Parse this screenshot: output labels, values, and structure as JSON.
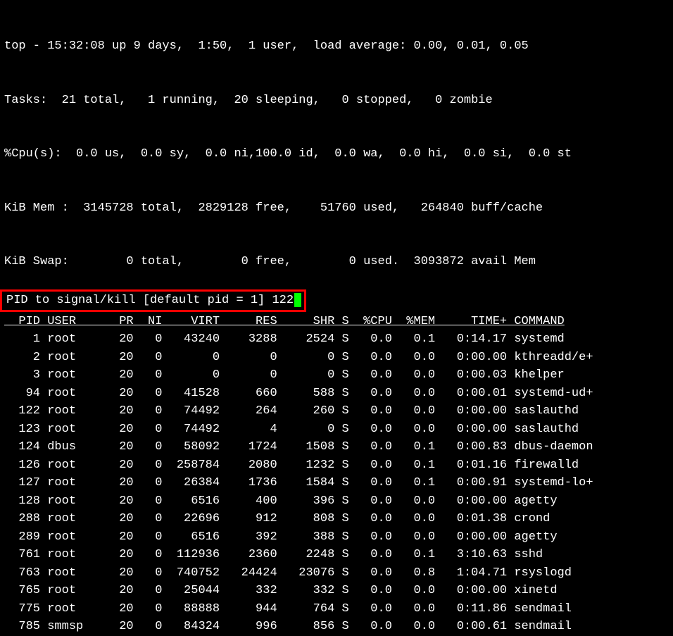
{
  "summary": {
    "line1": "top - 15:32:08 up 9 days,  1:50,  1 user,  load average: 0.00, 0.01, 0.05",
    "line2": "Tasks:  21 total,   1 running,  20 sleeping,   0 stopped,   0 zombie",
    "line3": "%Cpu(s):  0.0 us,  0.0 sy,  0.0 ni,100.0 id,  0.0 wa,  0.0 hi,  0.0 si,  0.0 st",
    "line4": "KiB Mem :  3145728 total,  2829128 free,    51760 used,   264840 buff/cache",
    "line5": "KiB Swap:        0 total,        0 free,        0 used.  3093872 avail Mem"
  },
  "prompt": {
    "text": "PID to signal/kill [default pid = 1] ",
    "value": "122"
  },
  "columns": {
    "pid": "PID",
    "user": "USER",
    "pr": "PR",
    "ni": "NI",
    "virt": "VIRT",
    "res": "RES",
    "shr": "SHR",
    "s": "S",
    "cpu": "%CPU",
    "mem": "%MEM",
    "time": "TIME+",
    "command": "COMMAND"
  },
  "processes": [
    {
      "pid": "1",
      "user": "root",
      "pr": "20",
      "ni": "0",
      "virt": "43240",
      "res": "3288",
      "shr": "2524",
      "s": "S",
      "cpu": "0.0",
      "mem": "0.1",
      "time": "0:14.17",
      "command": "systemd"
    },
    {
      "pid": "2",
      "user": "root",
      "pr": "20",
      "ni": "0",
      "virt": "0",
      "res": "0",
      "shr": "0",
      "s": "S",
      "cpu": "0.0",
      "mem": "0.0",
      "time": "0:00.00",
      "command": "kthreadd/e+"
    },
    {
      "pid": "3",
      "user": "root",
      "pr": "20",
      "ni": "0",
      "virt": "0",
      "res": "0",
      "shr": "0",
      "s": "S",
      "cpu": "0.0",
      "mem": "0.0",
      "time": "0:00.03",
      "command": "khelper"
    },
    {
      "pid": "94",
      "user": "root",
      "pr": "20",
      "ni": "0",
      "virt": "41528",
      "res": "660",
      "shr": "588",
      "s": "S",
      "cpu": "0.0",
      "mem": "0.0",
      "time": "0:00.01",
      "command": "systemd-ud+"
    },
    {
      "pid": "122",
      "user": "root",
      "pr": "20",
      "ni": "0",
      "virt": "74492",
      "res": "264",
      "shr": "260",
      "s": "S",
      "cpu": "0.0",
      "mem": "0.0",
      "time": "0:00.00",
      "command": "saslauthd"
    },
    {
      "pid": "123",
      "user": "root",
      "pr": "20",
      "ni": "0",
      "virt": "74492",
      "res": "4",
      "shr": "0",
      "s": "S",
      "cpu": "0.0",
      "mem": "0.0",
      "time": "0:00.00",
      "command": "saslauthd"
    },
    {
      "pid": "124",
      "user": "dbus",
      "pr": "20",
      "ni": "0",
      "virt": "58092",
      "res": "1724",
      "shr": "1508",
      "s": "S",
      "cpu": "0.0",
      "mem": "0.1",
      "time": "0:00.83",
      "command": "dbus-daemon"
    },
    {
      "pid": "126",
      "user": "root",
      "pr": "20",
      "ni": "0",
      "virt": "258784",
      "res": "2080",
      "shr": "1232",
      "s": "S",
      "cpu": "0.0",
      "mem": "0.1",
      "time": "0:01.16",
      "command": "firewalld"
    },
    {
      "pid": "127",
      "user": "root",
      "pr": "20",
      "ni": "0",
      "virt": "26384",
      "res": "1736",
      "shr": "1584",
      "s": "S",
      "cpu": "0.0",
      "mem": "0.1",
      "time": "0:00.91",
      "command": "systemd-lo+"
    },
    {
      "pid": "128",
      "user": "root",
      "pr": "20",
      "ni": "0",
      "virt": "6516",
      "res": "400",
      "shr": "396",
      "s": "S",
      "cpu": "0.0",
      "mem": "0.0",
      "time": "0:00.00",
      "command": "agetty"
    },
    {
      "pid": "288",
      "user": "root",
      "pr": "20",
      "ni": "0",
      "virt": "22696",
      "res": "912",
      "shr": "808",
      "s": "S",
      "cpu": "0.0",
      "mem": "0.0",
      "time": "0:01.38",
      "command": "crond"
    },
    {
      "pid": "289",
      "user": "root",
      "pr": "20",
      "ni": "0",
      "virt": "6516",
      "res": "392",
      "shr": "388",
      "s": "S",
      "cpu": "0.0",
      "mem": "0.0",
      "time": "0:00.00",
      "command": "agetty"
    },
    {
      "pid": "761",
      "user": "root",
      "pr": "20",
      "ni": "0",
      "virt": "112936",
      "res": "2360",
      "shr": "2248",
      "s": "S",
      "cpu": "0.0",
      "mem": "0.1",
      "time": "3:10.63",
      "command": "sshd"
    },
    {
      "pid": "763",
      "user": "root",
      "pr": "20",
      "ni": "0",
      "virt": "740752",
      "res": "24424",
      "shr": "23076",
      "s": "S",
      "cpu": "0.0",
      "mem": "0.8",
      "time": "1:04.71",
      "command": "rsyslogd"
    },
    {
      "pid": "765",
      "user": "root",
      "pr": "20",
      "ni": "0",
      "virt": "25044",
      "res": "332",
      "shr": "332",
      "s": "S",
      "cpu": "0.0",
      "mem": "0.0",
      "time": "0:00.00",
      "command": "xinetd"
    },
    {
      "pid": "775",
      "user": "root",
      "pr": "20",
      "ni": "0",
      "virt": "88888",
      "res": "944",
      "shr": "764",
      "s": "S",
      "cpu": "0.0",
      "mem": "0.0",
      "time": "0:11.86",
      "command": "sendmail"
    },
    {
      "pid": "785",
      "user": "smmsp",
      "pr": "20",
      "ni": "0",
      "virt": "84324",
      "res": "996",
      "shr": "856",
      "s": "S",
      "cpu": "0.0",
      "mem": "0.0",
      "time": "0:00.61",
      "command": "sendmail"
    }
  ]
}
